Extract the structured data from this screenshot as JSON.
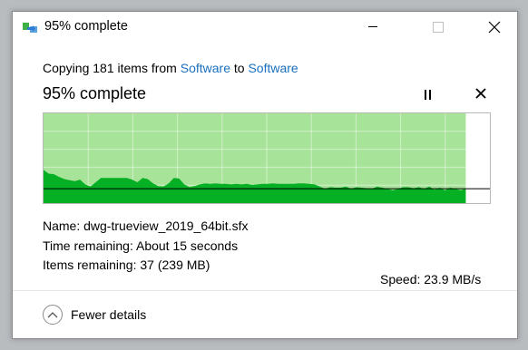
{
  "window": {
    "title": "95% complete",
    "icon": "copy-arrow-icon",
    "controls": [
      "minimize-icon",
      "maximize-icon",
      "close-icon"
    ]
  },
  "summary": {
    "prefix": "Copying 181 items from ",
    "source": "Software",
    "middle": " to ",
    "destination": "Software"
  },
  "progress": {
    "heading": "95% complete",
    "percent": 95,
    "pause_icon": "pause-icon",
    "cancel_icon": "close-icon"
  },
  "graph": {
    "speed_label": "Speed: 23.9 MB/s",
    "fill_color": "#a8e39a",
    "speed_area_color": "#06b025",
    "speed_line_color": "#000000",
    "current_speed_level": 0.16,
    "speed_history": [
      0.35,
      0.28,
      0.27,
      0.22,
      0.18,
      0.16,
      0.14,
      0.17,
      0.08,
      0.04,
      0.12,
      0.2,
      0.2,
      0.2,
      0.2,
      0.2,
      0.2,
      0.17,
      0.12,
      0.2,
      0.18,
      0.1,
      0.05,
      0.04,
      0.1,
      0.2,
      0.19,
      0.08,
      0.03,
      0.05,
      0.08,
      0.1,
      0.09,
      0.1,
      0.09,
      0.09,
      0.08,
      0.09,
      0.08,
      0.09,
      0.07,
      0.08,
      0.09,
      0.09,
      0.1,
      0.09,
      0.09,
      0.09,
      0.09,
      0.1,
      0.1,
      0.09,
      0.08,
      0.04,
      0.0,
      0.03,
      0.02,
      0.02,
      0.04,
      0.0,
      0.03,
      0.02,
      0.01,
      0.0,
      0.04,
      0.02,
      0.0,
      -0.03,
      0.0,
      0.03,
      0.03,
      0.01,
      0.03,
      0.0,
      0.04,
      -0.02,
      0.02,
      -0.03,
      0.02,
      0.0,
      -0.03,
      0.0
    ]
  },
  "details": {
    "name_label": "Name:",
    "name_value": "dwg-trueview_2019_64bit.sfx",
    "time_label": "Time remaining:",
    "time_value": "About 15 seconds",
    "items_label": "Items remaining:",
    "items_value": "37 (239 MB)"
  },
  "footer": {
    "toggle_label": "Fewer details",
    "toggle_icon": "chevron-up-icon"
  }
}
